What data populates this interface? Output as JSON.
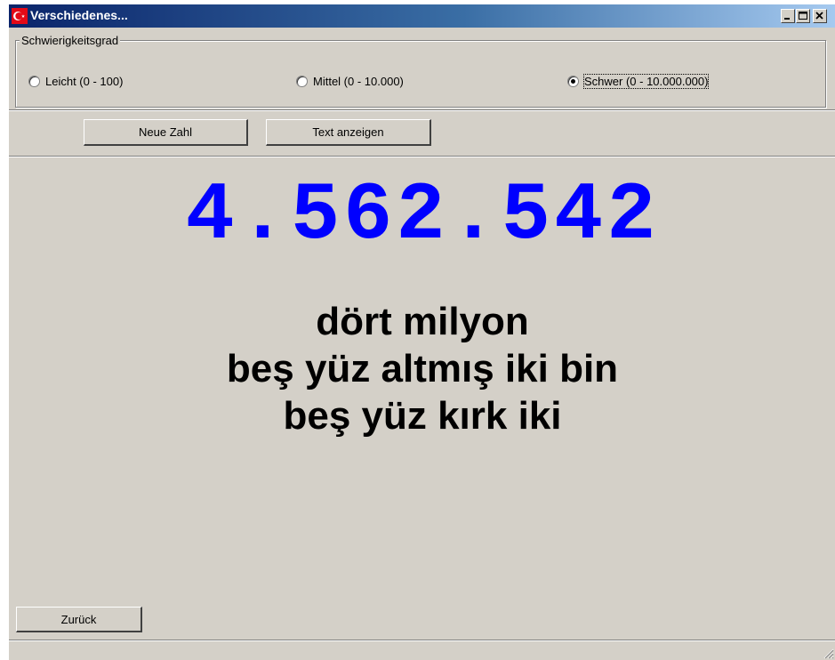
{
  "window": {
    "title": "Verschiedenes...",
    "controls": {
      "minimize": "minimize",
      "maximize": "maximize",
      "close": "close"
    }
  },
  "difficulty": {
    "legend": "Schwierigkeitsgrad",
    "options": [
      {
        "label": "Leicht (0 - 100)",
        "selected": false
      },
      {
        "label": "Mittel (0 - 10.000)",
        "selected": false
      },
      {
        "label": "Schwer (0 - 10.000.000)",
        "selected": true
      }
    ]
  },
  "toolbar": {
    "new_number_label": "Neue Zahl",
    "show_text_label": "Text anzeigen"
  },
  "display": {
    "number": "4.562.542",
    "number_color": "#0000ff",
    "words": [
      "dört milyon",
      "beş yüz altmış iki bin",
      "beş yüz kırk iki"
    ]
  },
  "footer": {
    "back_label": "Zurück"
  },
  "icons": {
    "app": "turkish-flag-icon",
    "grip": "resize-grip-icon"
  },
  "colors": {
    "titlebar_start": "#0a246a",
    "titlebar_end": "#a6caf0",
    "face": "#d4d0c8"
  }
}
